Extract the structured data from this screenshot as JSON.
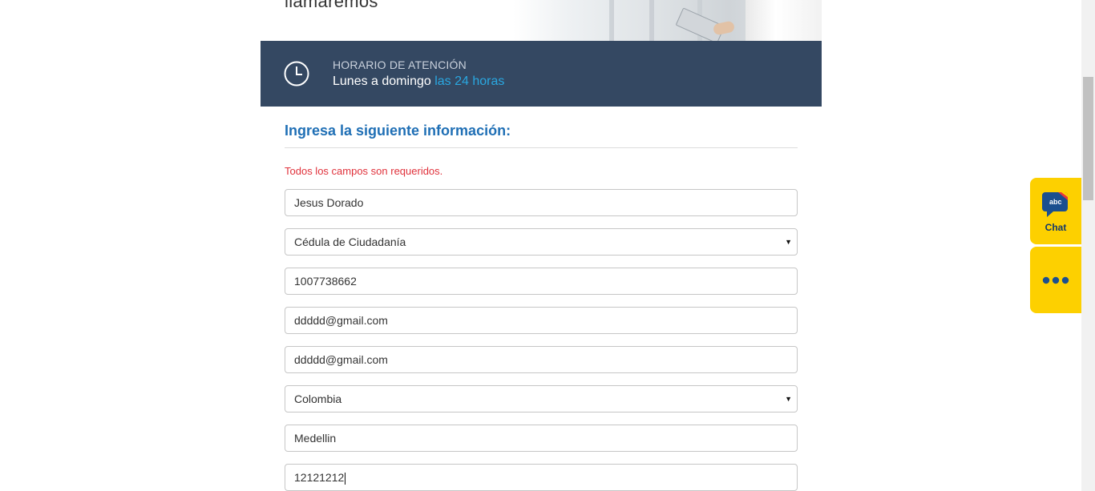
{
  "hero": {
    "title": "llamaremos"
  },
  "hours": {
    "label": "HORARIO DE ATENCIÓN",
    "days": "Lunes a domingo",
    "time": "las 24 horas",
    "icon": "clock-icon"
  },
  "form": {
    "title": "Ingresa la siguiente información:",
    "required_note": "Todos los campos son requeridos.",
    "fields": [
      {
        "type": "input",
        "value": "Jesus Dorado"
      },
      {
        "type": "select",
        "value": "Cédula de Ciudadanía"
      },
      {
        "type": "input",
        "value": "1007738662"
      },
      {
        "type": "input",
        "value": "ddddd@gmail.com"
      },
      {
        "type": "input",
        "value": "ddddd@gmail.com"
      },
      {
        "type": "select",
        "value": "Colombia"
      },
      {
        "type": "input",
        "value": "Medellin"
      },
      {
        "type": "input",
        "value": "12121212"
      }
    ]
  },
  "widgets": {
    "chat_label": "Chat",
    "chat_icon_text": "abc",
    "more_icon": "ellipsis-icon",
    "color": "#fdd000"
  },
  "colors": {
    "band": "#344862",
    "accent": "#2aa7e0",
    "title": "#1f6fb5",
    "required": "#e0313b"
  }
}
